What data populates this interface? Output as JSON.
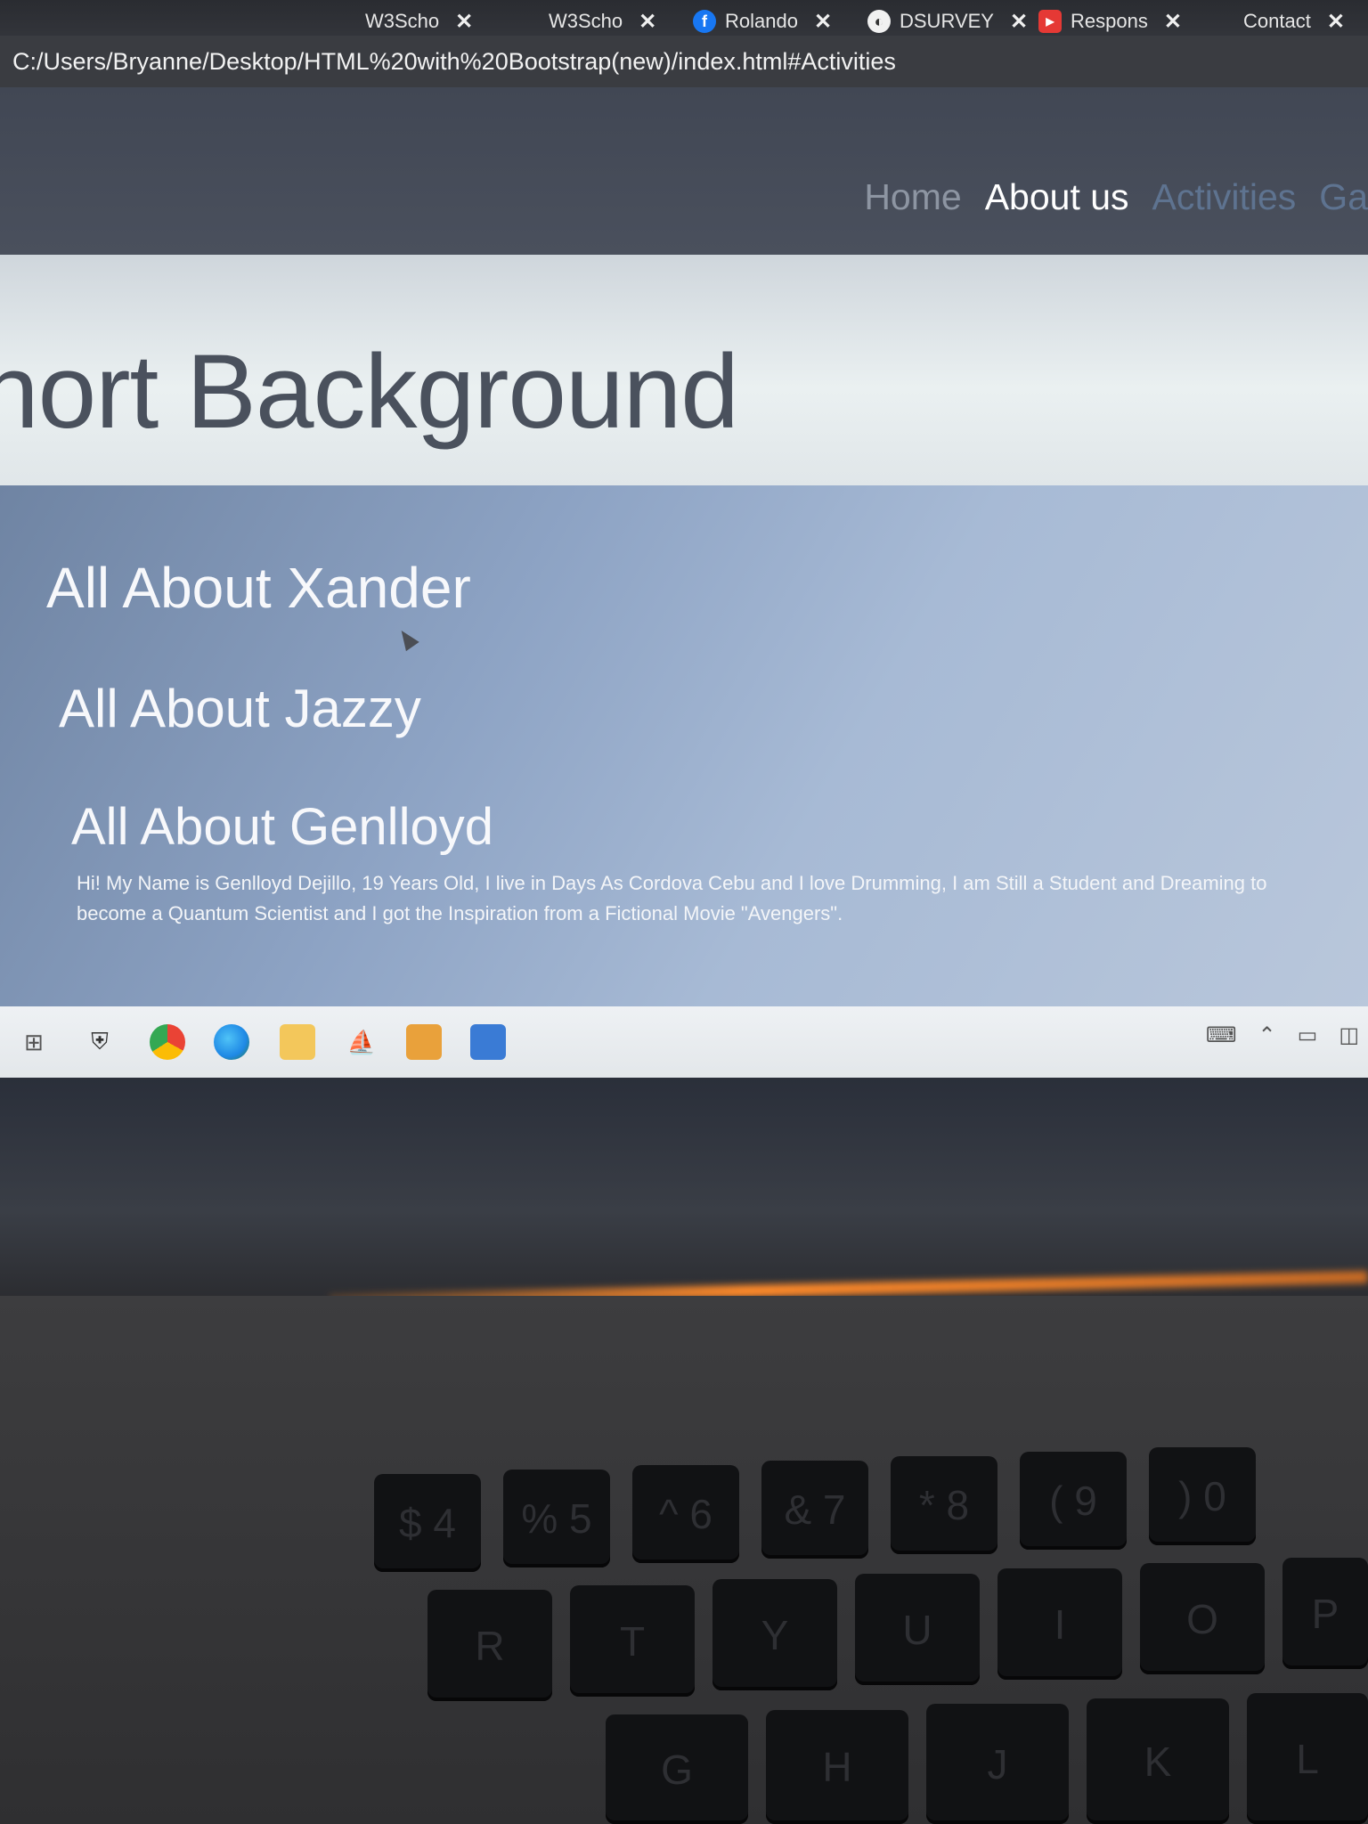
{
  "browser": {
    "tabs": [
      {
        "label": "W3Scho",
        "icon": "w3-icon"
      },
      {
        "label": "W3Scho",
        "icon": "w3-icon"
      },
      {
        "label": "Rolando",
        "icon": "facebook-icon"
      },
      {
        "label": "DSURVEY",
        "icon": "globe-icon"
      },
      {
        "label": "Respons",
        "icon": "youtube-icon"
      },
      {
        "label": "Contact",
        "icon": ""
      }
    ],
    "address": "C:/Users/Bryanne/Desktop/HTML%20with%20Bootstrap(new)/index.html#Activities"
  },
  "nav": {
    "items": [
      "Home",
      "About us",
      "Activities",
      "Ga"
    ]
  },
  "jumbotron": {
    "title": "hort Background"
  },
  "content": {
    "people": [
      {
        "heading": "All About Xander"
      },
      {
        "heading": "All About Jazzy"
      },
      {
        "heading": "All About Genlloyd"
      }
    ],
    "bio": "Hi! My Name is Genlloyd Dejillo, 19 Years Old, I live in Days As Cordova Cebu and I love Drumming, I am Still a Student and Dreaming to become a Quantum Scientist and I got the Inspiration from a Fictional Movie \"Avengers\"."
  },
  "keyboard": {
    "row1": [
      "$ 4",
      "% 5",
      "^ 6",
      "& 7",
      "* 8",
      "( 9",
      ") 0"
    ],
    "row2": [
      "R",
      "T",
      "Y",
      "U",
      "I",
      "O",
      "P"
    ],
    "row3": [
      "G",
      "H",
      "J",
      "K",
      "L"
    ]
  },
  "colors": {
    "navbar": "#474d59",
    "content_bg": "#8da3c4",
    "active_nav": "#ffffff"
  }
}
